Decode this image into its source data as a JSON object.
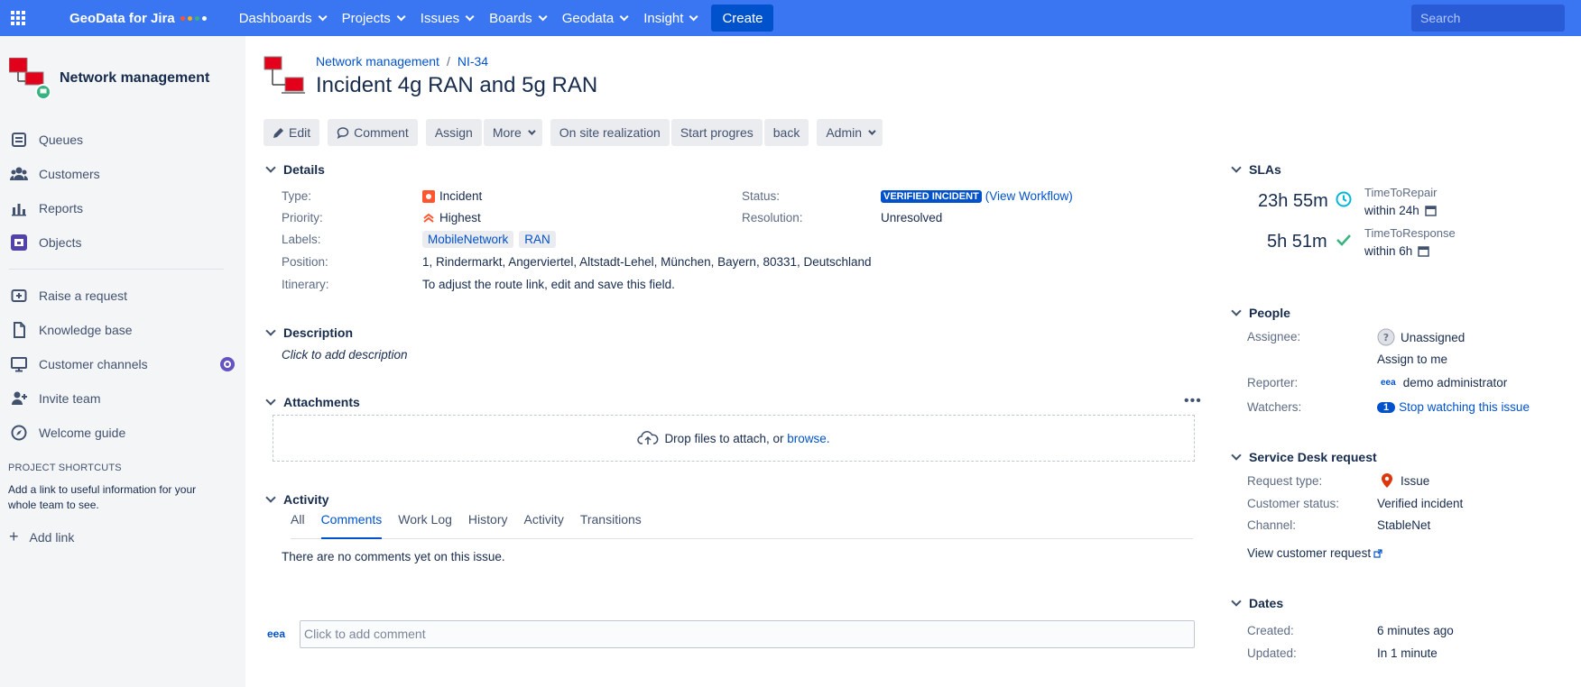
{
  "topnav": {
    "brand": "GeoData for Jira",
    "brand_dot_colors": [
      "#ff5630",
      "#ffab00",
      "#36b37e",
      "#ffffff"
    ],
    "menu": [
      {
        "label": "Dashboards"
      },
      {
        "label": "Projects"
      },
      {
        "label": "Issues"
      },
      {
        "label": "Boards"
      },
      {
        "label": "Geodata"
      },
      {
        "label": "Insight"
      }
    ],
    "create_label": "Create",
    "search_placeholder": "Search",
    "bg_color": "#3b76f2"
  },
  "sidebar": {
    "project_name": "Network management",
    "items": [
      {
        "label": "Queues",
        "icon": "queues-icon"
      },
      {
        "label": "Customers",
        "icon": "customers-icon"
      },
      {
        "label": "Reports",
        "icon": "reports-icon"
      },
      {
        "label": "Objects",
        "icon": "objects-icon"
      }
    ],
    "items2": [
      {
        "label": "Raise a request",
        "icon": "raise-request-icon"
      },
      {
        "label": "Knowledge base",
        "icon": "knowledge-base-icon"
      },
      {
        "label": "Customer channels",
        "icon": "customer-channels-icon"
      },
      {
        "label": "Invite team",
        "icon": "invite-team-icon"
      },
      {
        "label": "Welcome guide",
        "icon": "welcome-guide-icon"
      }
    ],
    "shortcuts_heading": "PROJECT SHORTCUTS",
    "shortcuts_text": "Add a link to useful information for your whole team to see.",
    "add_link": "Add link"
  },
  "issue": {
    "breadcrumb_project": "Network management",
    "breadcrumb_sep": "/",
    "key": "NI-34",
    "title": "Incident 4g RAN and 5g RAN"
  },
  "toolbar": {
    "edit": "Edit",
    "comment": "Comment",
    "assign": "Assign",
    "more": "More",
    "on_site": "On site realization",
    "start": "Start progres",
    "back": "back",
    "admin": "Admin"
  },
  "details": {
    "heading": "Details",
    "type_label": "Type:",
    "type_value": "Incident",
    "priority_label": "Priority:",
    "priority_value": "Highest",
    "labels_label": "Labels:",
    "labels": [
      "MobileNetwork",
      "RAN"
    ],
    "position_label": "Position:",
    "position_value": "1, Rindermarkt, Angerviertel, Altstadt-Lehel, München, Bayern, 80331, Deutschland",
    "itinerary_label": "Itinerary:",
    "itinerary_value": "To adjust the route link, edit and save this field.",
    "status_label": "Status:",
    "status_value": "VERIFIED INCIDENT",
    "view_workflow": "(View Workflow)",
    "resolution_label": "Resolution:",
    "resolution_value": "Unresolved"
  },
  "description": {
    "heading": "Description",
    "placeholder": "Click to add description"
  },
  "attachments": {
    "heading": "Attachments",
    "drop_text": "Drop files to attach, or",
    "browse": "browse."
  },
  "activity": {
    "heading": "Activity",
    "tabs": [
      "All",
      "Comments",
      "Work Log",
      "History",
      "Activity",
      "Transitions"
    ],
    "active_tab": "Comments",
    "empty_text": "There are no comments yet on this issue.",
    "comment_placeholder": "Click to add comment",
    "avatar_text": "eea"
  },
  "slas": {
    "heading": "SLAs",
    "items": [
      {
        "time": "23h 55m",
        "name": "TimeToRepair",
        "goal": "within 24h",
        "state": "running"
      },
      {
        "time": "5h 51m",
        "name": "TimeToResponse",
        "goal": "within 6h",
        "state": "met"
      }
    ]
  },
  "people": {
    "heading": "People",
    "assignee_label": "Assignee:",
    "assignee_value": "Unassigned",
    "assign_to_me": "Assign to me",
    "reporter_label": "Reporter:",
    "reporter_avatar": "eea",
    "reporter_value": "demo administrator",
    "watchers_label": "Watchers:",
    "watchers_count": "1",
    "watch_link": "Stop watching this issue"
  },
  "servicedesk": {
    "heading": "Service Desk request",
    "request_type_label": "Request type:",
    "request_type_value": "Issue",
    "customer_status_label": "Customer status:",
    "customer_status_value": "Verified incident",
    "channel_label": "Channel:",
    "channel_value": "StableNet",
    "view_request": "View customer request"
  },
  "dates": {
    "heading": "Dates",
    "created_label": "Created:",
    "created_value": "6 minutes ago",
    "updated_label": "Updated:",
    "updated_value": "In 1 minute"
  }
}
